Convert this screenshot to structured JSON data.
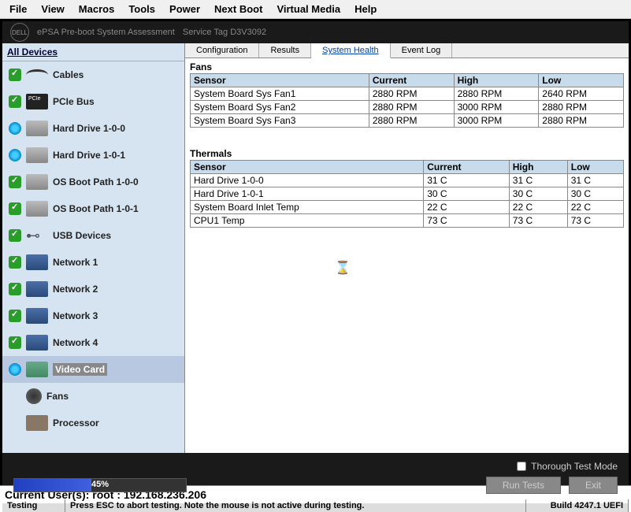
{
  "menubar": [
    "File",
    "View",
    "Macros",
    "Tools",
    "Power",
    "Next Boot",
    "Virtual Media",
    "Help"
  ],
  "header": {
    "logo": "DELL",
    "title": "ePSA Pre-boot System Assessment",
    "service_tag": "Service Tag D3V3092"
  },
  "sidebar": {
    "title": "All Devices",
    "items": [
      {
        "label": "Cables",
        "status": "check",
        "icon": "cable"
      },
      {
        "label": "PCIe Bus",
        "status": "check",
        "icon": "pcie"
      },
      {
        "label": "Hard Drive 1-0-0",
        "status": "spin",
        "icon": "hdd"
      },
      {
        "label": "Hard Drive 1-0-1",
        "status": "spin",
        "icon": "hdd"
      },
      {
        "label": "OS Boot Path 1-0-0",
        "status": "check",
        "icon": "hdd"
      },
      {
        "label": "OS Boot Path 1-0-1",
        "status": "check",
        "icon": "hdd"
      },
      {
        "label": "USB Devices",
        "status": "check",
        "icon": "usb"
      },
      {
        "label": "Network 1",
        "status": "check",
        "icon": "net"
      },
      {
        "label": "Network 2",
        "status": "check",
        "icon": "net"
      },
      {
        "label": "Network 3",
        "status": "check",
        "icon": "net"
      },
      {
        "label": "Network 4",
        "status": "check",
        "icon": "net"
      },
      {
        "label": "Video Card",
        "status": "spin",
        "icon": "video",
        "selected": true
      },
      {
        "label": "Fans",
        "status": "none",
        "icon": "fan"
      },
      {
        "label": "Processor",
        "status": "none",
        "icon": "cpu"
      }
    ]
  },
  "tabs": {
    "items": [
      "Configuration",
      "Results",
      "System Health",
      "Event Log"
    ],
    "active": 2
  },
  "fans": {
    "title": "Fans",
    "headers": [
      "Sensor",
      "Current",
      "High",
      "Low"
    ],
    "rows": [
      [
        "System Board Sys Fan1",
        "2880 RPM",
        "2880 RPM",
        "2640 RPM"
      ],
      [
        "System Board Sys Fan2",
        "2880 RPM",
        "3000 RPM",
        "2880 RPM"
      ],
      [
        "System Board Sys Fan3",
        "2880 RPM",
        "3000 RPM",
        "2880 RPM"
      ]
    ]
  },
  "thermals": {
    "title": "Thermals",
    "headers": [
      "Sensor",
      "Current",
      "High",
      "Low"
    ],
    "rows": [
      [
        "Hard Drive 1-0-0",
        "31 C",
        "31 C",
        "31 C"
      ],
      [
        "Hard Drive 1-0-1",
        "30 C",
        "30 C",
        "30 C"
      ],
      [
        "System Board Inlet Temp",
        "22 C",
        "22 C",
        "22 C"
      ],
      [
        "CPU1 Temp",
        "73 C",
        "73 C",
        "73 C"
      ]
    ]
  },
  "footer": {
    "thorough_label": "Thorough Test Mode",
    "run_tests": "Run Tests",
    "exit": "Exit",
    "progress_pct": "45%"
  },
  "status": {
    "state": "Testing",
    "message": "Press ESC to abort testing.  Note the mouse is not active during testing.",
    "build": "Build  4247.1 UEFI"
  },
  "bottom_user": "Current User(s): root : 192.168.236.206"
}
